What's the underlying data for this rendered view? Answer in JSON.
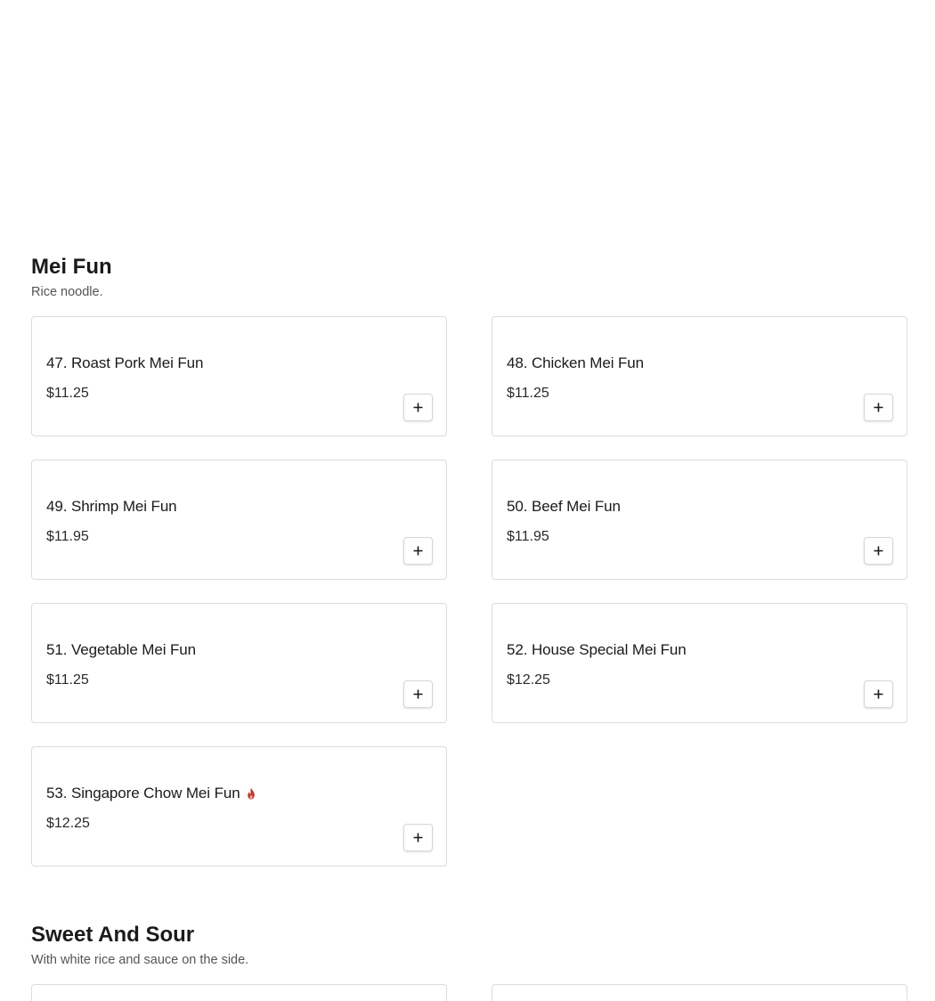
{
  "sections": [
    {
      "title": "Mei Fun",
      "description": "Rice noodle.",
      "items": [
        {
          "name": "47. Roast Pork Mei Fun",
          "price": "$11.25",
          "spicy": false
        },
        {
          "name": "48. Chicken Mei Fun",
          "price": "$11.25",
          "spicy": false
        },
        {
          "name": "49. Shrimp Mei Fun",
          "price": "$11.95",
          "spicy": false
        },
        {
          "name": "50. Beef Mei Fun",
          "price": "$11.95",
          "spicy": false
        },
        {
          "name": "51. Vegetable Mei Fun",
          "price": "$11.25",
          "spicy": false
        },
        {
          "name": "52. House Special Mei Fun",
          "price": "$12.25",
          "spicy": false
        },
        {
          "name": "53. Singapore Chow Mei Fun",
          "price": "$12.25",
          "spicy": true
        }
      ]
    },
    {
      "title": "Sweet And Sour",
      "description": "With white rice and sauce on the side.",
      "items": []
    }
  ],
  "icons": {
    "add": "plus-icon",
    "spicy": "flame-icon"
  },
  "colors": {
    "spicy": "#c0392b",
    "card_border": "#dcdcdc"
  }
}
